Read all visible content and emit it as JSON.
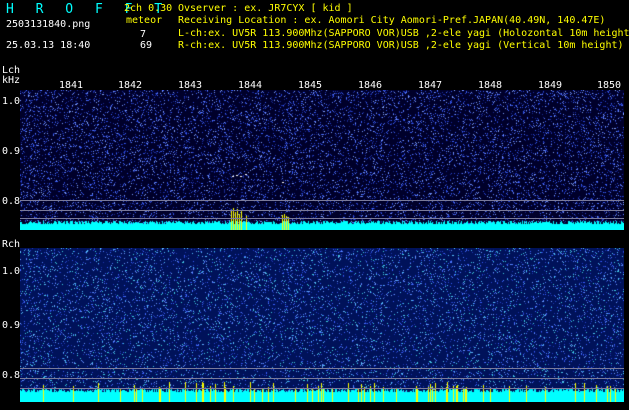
{
  "header": {
    "logo": "H R O F F T",
    "filename": "2503131840.png",
    "datetime": "25.03.13 18:40",
    "channel": "2ch 0.30",
    "meteor_label": "meteor",
    "meteor_count_l": "7",
    "meteor_count_r": "69"
  },
  "info": {
    "observer": "Ovserver            : ex. JR7CYX [ kid ]",
    "location": "Receiving Location : ex. Aomori City Aomori-Pref.JAPAN(40.49N, 140.47E)",
    "lch": "L-ch:ex. UV5R 113.900Mhz(SAPPORO VOR)USB ,2-ele yagi (Holozontal 10m height)",
    "rch": "R-ch:ex. UV5R 113.900Mhz(SAPPORO VOR)USB ,2-ele yagi (Vertical 10m height)"
  },
  "panels": {
    "lch_label": "Lch",
    "khz_label": "kHz",
    "rch_label": "Rch"
  },
  "time_axis": [
    "1841",
    "1842",
    "1843",
    "1844",
    "1845",
    "1846",
    "1847",
    "1848",
    "1849",
    "1850"
  ],
  "freq_axis": [
    "1.0",
    "0.9",
    "0.8"
  ],
  "colors": {
    "logo": "#00ffff",
    "labels": "#ffff00",
    "text": "#ffffff",
    "spectrum_bg_top": "#00002a",
    "spectrum_bg_bottom": "#00125a",
    "noise_band": "#00ffff",
    "meteor_echo": "#ffff00"
  }
}
